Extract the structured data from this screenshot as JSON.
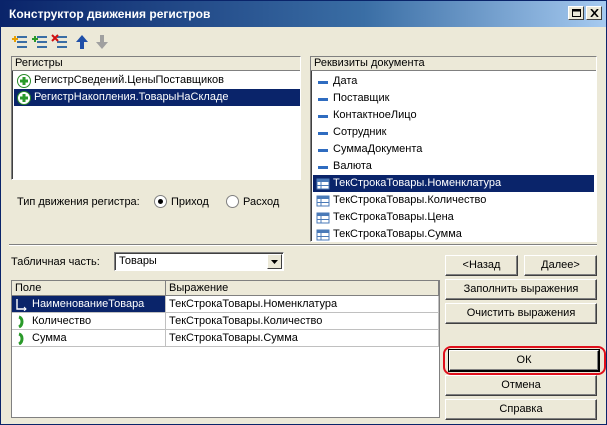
{
  "window": {
    "title": "Конструктор движения регистров"
  },
  "registers": {
    "header": "Регистры",
    "items": [
      {
        "label": "РегистрСведений.ЦеныПоставщиков",
        "icon": "plus-icon",
        "selected": false
      },
      {
        "label": "РегистрНакопления.ТоварыНаСкладе",
        "icon": "plus-icon",
        "selected": true
      }
    ]
  },
  "movement_type": {
    "label": "Тип движения регистра:",
    "options": [
      "Приход",
      "Расход"
    ],
    "selected": "Приход"
  },
  "attributes": {
    "header": "Реквизиты документа",
    "items": [
      {
        "label": "Дата",
        "icon": "attribute-icon",
        "selected": false
      },
      {
        "label": "Поставщик",
        "icon": "attribute-icon",
        "selected": false
      },
      {
        "label": "КонтактноеЛицо",
        "icon": "attribute-icon",
        "selected": false
      },
      {
        "label": "Сотрудник",
        "icon": "attribute-icon",
        "selected": false
      },
      {
        "label": "СуммаДокумента",
        "icon": "attribute-icon",
        "selected": false
      },
      {
        "label": "Валюта",
        "icon": "attribute-icon",
        "selected": false
      },
      {
        "label": "ТекСтрокаТовары.Номенклатура",
        "icon": "table-attribute-icon",
        "selected": true
      },
      {
        "label": "ТекСтрокаТовары.Количество",
        "icon": "table-attribute-icon",
        "selected": false
      },
      {
        "label": "ТекСтрокаТовары.Цена",
        "icon": "table-attribute-icon",
        "selected": false
      },
      {
        "label": "ТекСтрокаТовары.Сумма",
        "icon": "table-attribute-icon",
        "selected": false
      }
    ]
  },
  "tabular": {
    "label": "Табличная часть:",
    "value": "Товары"
  },
  "grid": {
    "columns": [
      "Поле",
      "Выражение"
    ],
    "rows": [
      {
        "field": "НаименованиеТовара",
        "expression": "ТекСтрокаТовары.Номенклатура",
        "icon": "dimension-icon",
        "selected": true
      },
      {
        "field": "Количество",
        "expression": "ТекСтрокаТовары.Количество",
        "icon": "resource-icon",
        "selected": false
      },
      {
        "field": "Сумма",
        "expression": "ТекСтрокаТовары.Сумма",
        "icon": "resource-icon",
        "selected": false
      }
    ]
  },
  "buttons": {
    "back": "<Назад",
    "next": "Далее>",
    "fill": "Заполнить выражения",
    "clear": "Очистить выражения",
    "ok": "ОК",
    "cancel": "Отмена",
    "help": "Справка"
  },
  "colors": {
    "selection": "#0a246a",
    "highlight_ring": "#e0101c"
  }
}
